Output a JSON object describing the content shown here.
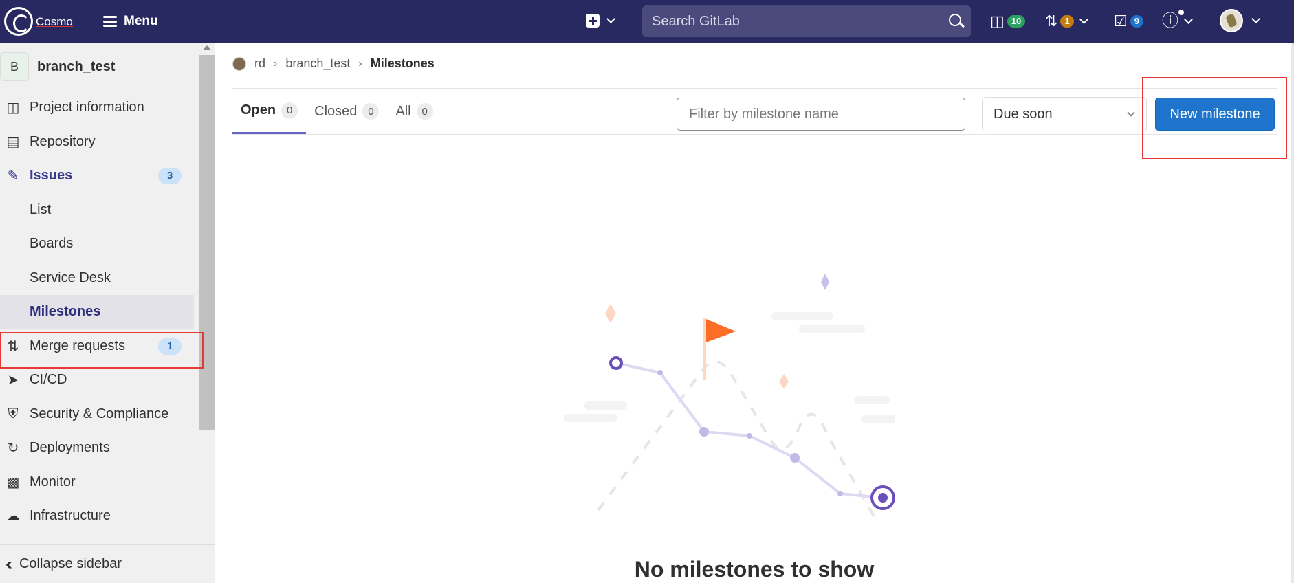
{
  "header": {
    "logo_text": "Cosmo",
    "menu_label": "Menu",
    "search_placeholder": "Search GitLab",
    "issues_count": "10",
    "mr_count": "1",
    "todo_count": "9"
  },
  "sidebar": {
    "project_initial": "B",
    "project_name": "branch_test",
    "items": [
      {
        "label": "Project information",
        "icon": "info-icon"
      },
      {
        "label": "Repository",
        "icon": "doc-icon"
      },
      {
        "label": "Issues",
        "icon": "issues-icon",
        "count": "3"
      },
      {
        "label": "List"
      },
      {
        "label": "Boards"
      },
      {
        "label": "Service Desk"
      },
      {
        "label": "Milestones"
      },
      {
        "label": "Merge requests",
        "icon": "merge-icon",
        "count": "1"
      },
      {
        "label": "CI/CD",
        "icon": "rocket-icon"
      },
      {
        "label": "Security & Compliance",
        "icon": "shield-icon"
      },
      {
        "label": "Deployments",
        "icon": "deploy-icon"
      },
      {
        "label": "Monitor",
        "icon": "monitor-icon"
      },
      {
        "label": "Infrastructure",
        "icon": "cloud-icon"
      }
    ],
    "collapse_label": "Collapse sidebar"
  },
  "breadcrumb": {
    "group": "rd",
    "project": "branch_test",
    "current": "Milestones"
  },
  "tabs": [
    {
      "label": "Open",
      "count": "0"
    },
    {
      "label": "Closed",
      "count": "0"
    },
    {
      "label": "All",
      "count": "0"
    }
  ],
  "filter": {
    "placeholder": "Filter by milestone name"
  },
  "sort": {
    "selected": "Due soon"
  },
  "new_button": "New milestone",
  "empty_state": {
    "title": "No milestones to show"
  },
  "colors": {
    "topbar": "#292961",
    "accent": "#1f75cb",
    "highlight": "#e53935",
    "flag": "#fc6d26",
    "path": "#6b4fbb"
  }
}
